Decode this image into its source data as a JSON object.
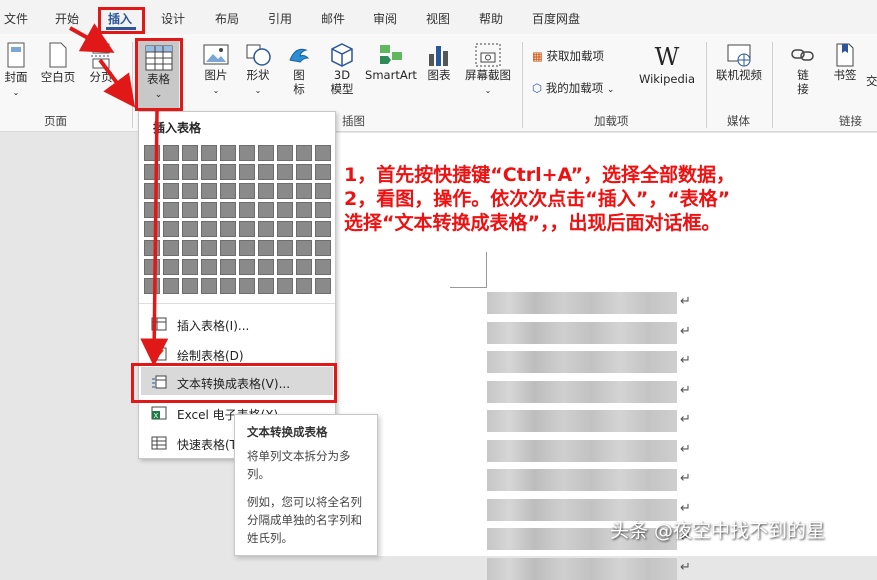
{
  "tabs": [
    "文件",
    "开始",
    "插入",
    "设计",
    "布局",
    "引用",
    "邮件",
    "审阅",
    "视图",
    "帮助",
    "百度网盘"
  ],
  "ribbon": {
    "cover": "封面",
    "blank_page": "空白页",
    "page_break": "分页",
    "table": "表格",
    "picture": "图片",
    "shapes": "形状",
    "icons_l1": "图",
    "icons_l2": "标",
    "model_l1": "3D",
    "model_l2": "模型",
    "smartart": "SmartArt",
    "chart": "图表",
    "screenshot": "屏幕截图",
    "get_addins": "获取加载项",
    "my_addins": "我的加载项",
    "wikipedia": "Wikipedia",
    "online_video": "联机视频",
    "link_l1": "链",
    "link_l2": "接",
    "bookmark": "书签",
    "crossref": "交",
    "groups": {
      "pages": "页面",
      "illustrations": "插图",
      "addins": "加载项",
      "media": "媒体",
      "links": "链接"
    }
  },
  "menu": {
    "title": "插入表格",
    "items": [
      "插入表格(I)...",
      "绘制表格(D)",
      "文本转换成表格(V)...",
      "Excel 电子表格(X)",
      "快速表格(T)"
    ]
  },
  "tooltip": {
    "title": "文本转换成表格",
    "line1": "将单列文本拆分为多",
    "line2": "列。",
    "line3": "例如，您可以将全名列",
    "line4": "分隔成单独的名字列和",
    "line5": "姓氏列。"
  },
  "annotation": {
    "line1": "1，首先按快捷键“Ctrl+A”，选择全部数据，",
    "line2": "2，看图，操作。依次次点击“插入”，“表格”",
    "line3": "选择“文本转换成表格”，，出现后面对话框。"
  },
  "watermark": "头条 @夜空中找不到的星",
  "colors": {
    "accent": "#2b579a",
    "annotation_red": "#e01818"
  }
}
